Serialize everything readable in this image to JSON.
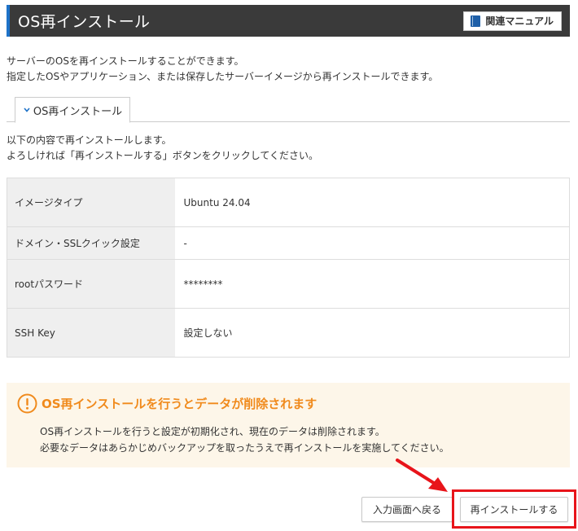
{
  "header": {
    "title": "OS再インストール",
    "manual_button": "関連マニュアル"
  },
  "intro": {
    "line1": "サーバーのOSを再インストールすることができます。",
    "line2": "指定したOSやアプリケーション、または保存したサーバーイメージから再インストールできます。"
  },
  "tabs": {
    "active": "OS再インストール"
  },
  "lead": {
    "line1": "以下の内容で再インストールします。",
    "line2": "よろしければ「再インストールする」ボタンをクリックしてください。"
  },
  "summary": {
    "rows": [
      {
        "label": "イメージタイプ",
        "value": "Ubuntu 24.04"
      },
      {
        "label": "ドメイン・SSLクイック設定",
        "value": "-"
      },
      {
        "label": "rootパスワード",
        "value": "********"
      },
      {
        "label": "SSH Key",
        "value": "設定しない"
      }
    ]
  },
  "warning": {
    "title": "OS再インストールを行うとデータが削除されます",
    "line1": "OS再インストールを行うと設定が初期化され、現在のデータは削除されます。",
    "line2": "必要なデータはあらかじめバックアップを取ったうえで再インストールを実施してください。"
  },
  "actions": {
    "back": "入力画面へ戻る",
    "reinstall": "再インストールする"
  },
  "colors": {
    "header_bg": "#3a3a3a",
    "header_accent": "#1e72c8",
    "warning_text": "#f08a1c",
    "warning_bg": "#fdf6e9",
    "highlight": "#e8141a"
  },
  "icons": {
    "manual": "book-icon",
    "tab": "chevron-down-icon",
    "warning": "exclamation-circle-icon",
    "annotation": "red-arrow-icon"
  }
}
